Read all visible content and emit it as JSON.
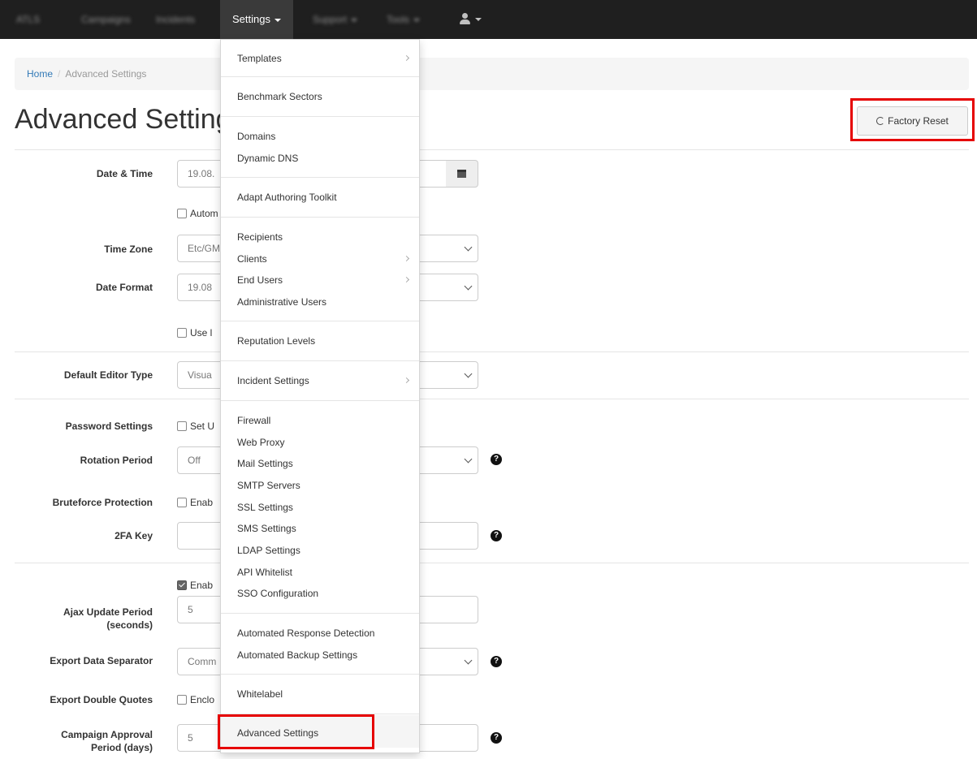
{
  "nav": {
    "brand": "ATLS",
    "items": [
      "Campaigns",
      "Incidents"
    ],
    "active": "Settings",
    "items_after": [
      "Support",
      "Tools"
    ]
  },
  "breadcrumb": {
    "home": "Home",
    "separator": "/",
    "current": "Advanced Settings"
  },
  "page": {
    "title": "Advanced Settings",
    "reset_label": "Factory Reset"
  },
  "colors": {
    "navbar": "#1f1f1f",
    "highlight": "#e60000",
    "link": "#337ab7"
  },
  "form": {
    "date_time": {
      "label": "Date & Time",
      "value": "19.08."
    },
    "auto_label": "Autom",
    "time_zone": {
      "label": "Time Zone",
      "value": "Etc/GM"
    },
    "date_format": {
      "label": "Date Format",
      "value": "19.08"
    },
    "use_label": "Use l",
    "editor_type": {
      "label": "Default Editor Type",
      "value": "Visua"
    },
    "password": {
      "label": "Password Settings",
      "check": "Set U"
    },
    "rotation": {
      "label": "Rotation Period",
      "value": "Off"
    },
    "bruteforce": {
      "label": "Bruteforce Protection",
      "check": "Enab"
    },
    "twofa": {
      "label": "2FA Key",
      "value": ""
    },
    "enable_label": "Enab",
    "ajax": {
      "label_line1": "Ajax Update Period",
      "label_line2": "(seconds)",
      "value": "5"
    },
    "separator": {
      "label": "Export Data Separator",
      "value": "Comm"
    },
    "quotes": {
      "label": "Export Double Quotes",
      "check": "Enclo"
    },
    "approval": {
      "label_line1": "Campaign Approval",
      "label_line2": "Period (days)",
      "value": "5"
    },
    "help_glyph": "?"
  },
  "menu": {
    "templates": "Templates",
    "benchmark": "Benchmark Sectors",
    "domains": "Domains",
    "dynamic_dns": "Dynamic DNS",
    "adapt": "Adapt Authoring Toolkit",
    "recipients": "Recipients",
    "clients": "Clients",
    "end_users": "End Users",
    "admin_users": "Administrative Users",
    "reputation": "Reputation Levels",
    "incident_settings": "Incident Settings",
    "firewall": "Firewall",
    "web_proxy": "Web Proxy",
    "mail_settings": "Mail Settings",
    "smtp_servers": "SMTP Servers",
    "ssl_settings": "SSL Settings",
    "sms_settings": "SMS Settings",
    "ldap_settings": "LDAP Settings",
    "api_whitelist": "API Whitelist",
    "sso": "SSO Configuration",
    "response_detection": "Automated Response Detection",
    "backup": "Automated Backup Settings",
    "whitelabel": "Whitelabel",
    "advanced": "Advanced Settings"
  }
}
